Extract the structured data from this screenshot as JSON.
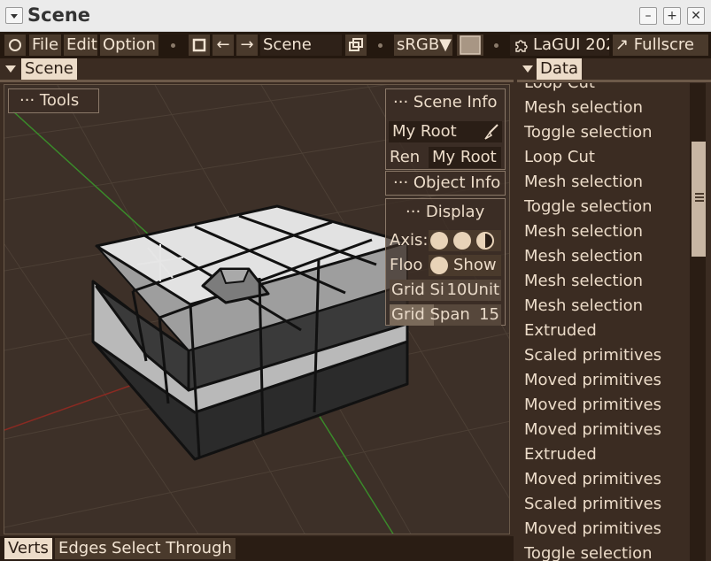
{
  "window": {
    "title": "Scene",
    "minimize": "–",
    "restore": "+",
    "close": "✕"
  },
  "toolbar": {
    "file": "File",
    "edit": "Edit",
    "option": "Option",
    "back": "←",
    "forward": "→",
    "view_name": "Scene",
    "color_space": "sRGB▼",
    "app_name": "LaGUI 202",
    "fullscreen": "↗ Fullscre"
  },
  "scene_panel": {
    "header": "Scene"
  },
  "data_panel": {
    "header": "Data"
  },
  "viewport": {
    "tools_label": "··· Tools",
    "scene_info": {
      "label": "··· Scene Info",
      "root_value": "My Root",
      "ren_label": "Ren",
      "ren_value": "My Root"
    },
    "object_info": {
      "label": "··· Object Info"
    },
    "display": {
      "label": "··· Display",
      "axis_label": "Axis:",
      "floor_label": "Floo",
      "floor_value": "Show",
      "grid_size_label": "Grid Si",
      "grid_size_value": "10Unit",
      "grid_span_label": "Grid Span",
      "grid_span_value": "15",
      "grid_span_fraction": 0.4
    }
  },
  "bottom_bar": {
    "verts": "Verts",
    "edges": "Edges",
    "select_through": "Select Through"
  },
  "history": [
    "Loop Cut",
    "Mesh selection",
    "Toggle selection",
    "Loop Cut",
    "Mesh selection",
    "Toggle selection",
    "Mesh selection",
    "Mesh selection",
    "Mesh selection",
    "Mesh selection",
    "Extruded",
    "Scaled primitives",
    "Moved primitives",
    "Moved primitives",
    "Moved primitives",
    "Extruded",
    "Moved primitives",
    "Scaled primitives",
    "Moved primitives",
    "Toggle selection"
  ],
  "colors": {
    "background": "#3b2c22",
    "accent": "#ecdcc9",
    "panel": "#4a3a2c"
  }
}
